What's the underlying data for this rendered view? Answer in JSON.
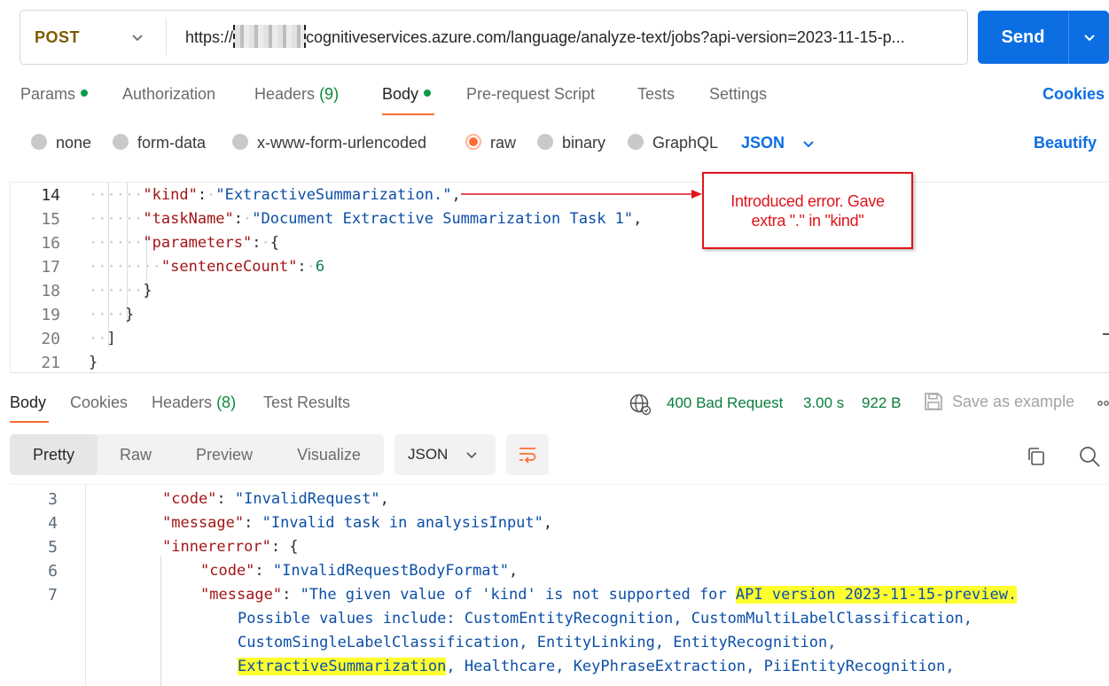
{
  "request": {
    "method": "POST",
    "url_prefix": "https://",
    "url_rest": "cognitiveservices.azure.com/language/analyze-text/jobs?api-version=2023-11-15-p...",
    "send_label": "Send"
  },
  "tabs": {
    "params": "Params",
    "authorization": "Authorization",
    "headers": "Headers",
    "headers_count": "(9)",
    "body": "Body",
    "prerequest": "Pre-request Script",
    "tests": "Tests",
    "settings": "Settings",
    "cookies": "Cookies"
  },
  "body_types": {
    "none": "none",
    "form_data": "form-data",
    "urlencoded": "x-www-form-urlencoded",
    "raw": "raw",
    "binary": "binary",
    "graphql": "GraphQL",
    "language": "JSON",
    "beautify": "Beautify"
  },
  "request_editor": {
    "line_numbers": [
      "14",
      "15",
      "16",
      "17",
      "18",
      "19",
      "20",
      "21"
    ],
    "kind_key": "\"kind\"",
    "kind_value": "\"ExtractiveSummarization.\"",
    "taskname_key": "\"taskName\"",
    "taskname_value": "\"Document Extractive Summarization Task 1\"",
    "parameters_key": "\"parameters\"",
    "sentencecount_key": "\"sentenceCount\"",
    "sentencecount_value": "6"
  },
  "annotation": {
    "line1": "Introduced error. Gave",
    "line2": "extra \".\" in \"kind\""
  },
  "response_tabs": {
    "body": "Body",
    "cookies": "Cookies",
    "headers": "Headers",
    "headers_count": "(8)",
    "test_results": "Test Results"
  },
  "response_status": {
    "status": "400 Bad Request",
    "time": "3.00 s",
    "size": "922 B",
    "save_example": "Save as example"
  },
  "response_view": {
    "pretty": "Pretty",
    "raw": "Raw",
    "preview": "Preview",
    "visualize": "Visualize",
    "format": "JSON"
  },
  "response_editor": {
    "line_numbers": [
      "3",
      "4",
      "5",
      "6",
      "7"
    ],
    "code_key": "\"code\"",
    "code_value": "\"InvalidRequest\"",
    "message_key": "\"message\"",
    "message_value": "\"Invalid task in analysisInput\"",
    "innererror_key": "\"innererror\"",
    "inner_code_value": "\"InvalidRequestBodyFormat\"",
    "inner_message_start": "\"The given value of 'kind' is not supported for ",
    "inner_message_highlight": "API version 2023-11-15-preview.",
    "wrap1": "Possible values include: CustomEntityRecognition, CustomMultiLabelClassification,",
    "wrap2": "CustomSingleLabelClassification, EntityLinking, EntityRecognition,",
    "wrap3_highlight": "ExtractiveSummarization",
    "wrap3_rest": ", Healthcare, KeyPhraseExtraction, PiiEntityRecognition,"
  },
  "colors": {
    "accent_orange": "#ff6c37",
    "brand_blue": "#0c6ee3",
    "method_post": "#7d5b00",
    "success_green": "#0a7d3c",
    "annotation_red": "#e0141b",
    "highlight_yellow": "#ffff2e"
  },
  "icons": [
    "chevron-down-icon",
    "globe-icon",
    "floppy-disk-icon",
    "copy-icon",
    "search-icon",
    "wrap-lines-icon",
    "more-icon"
  ]
}
